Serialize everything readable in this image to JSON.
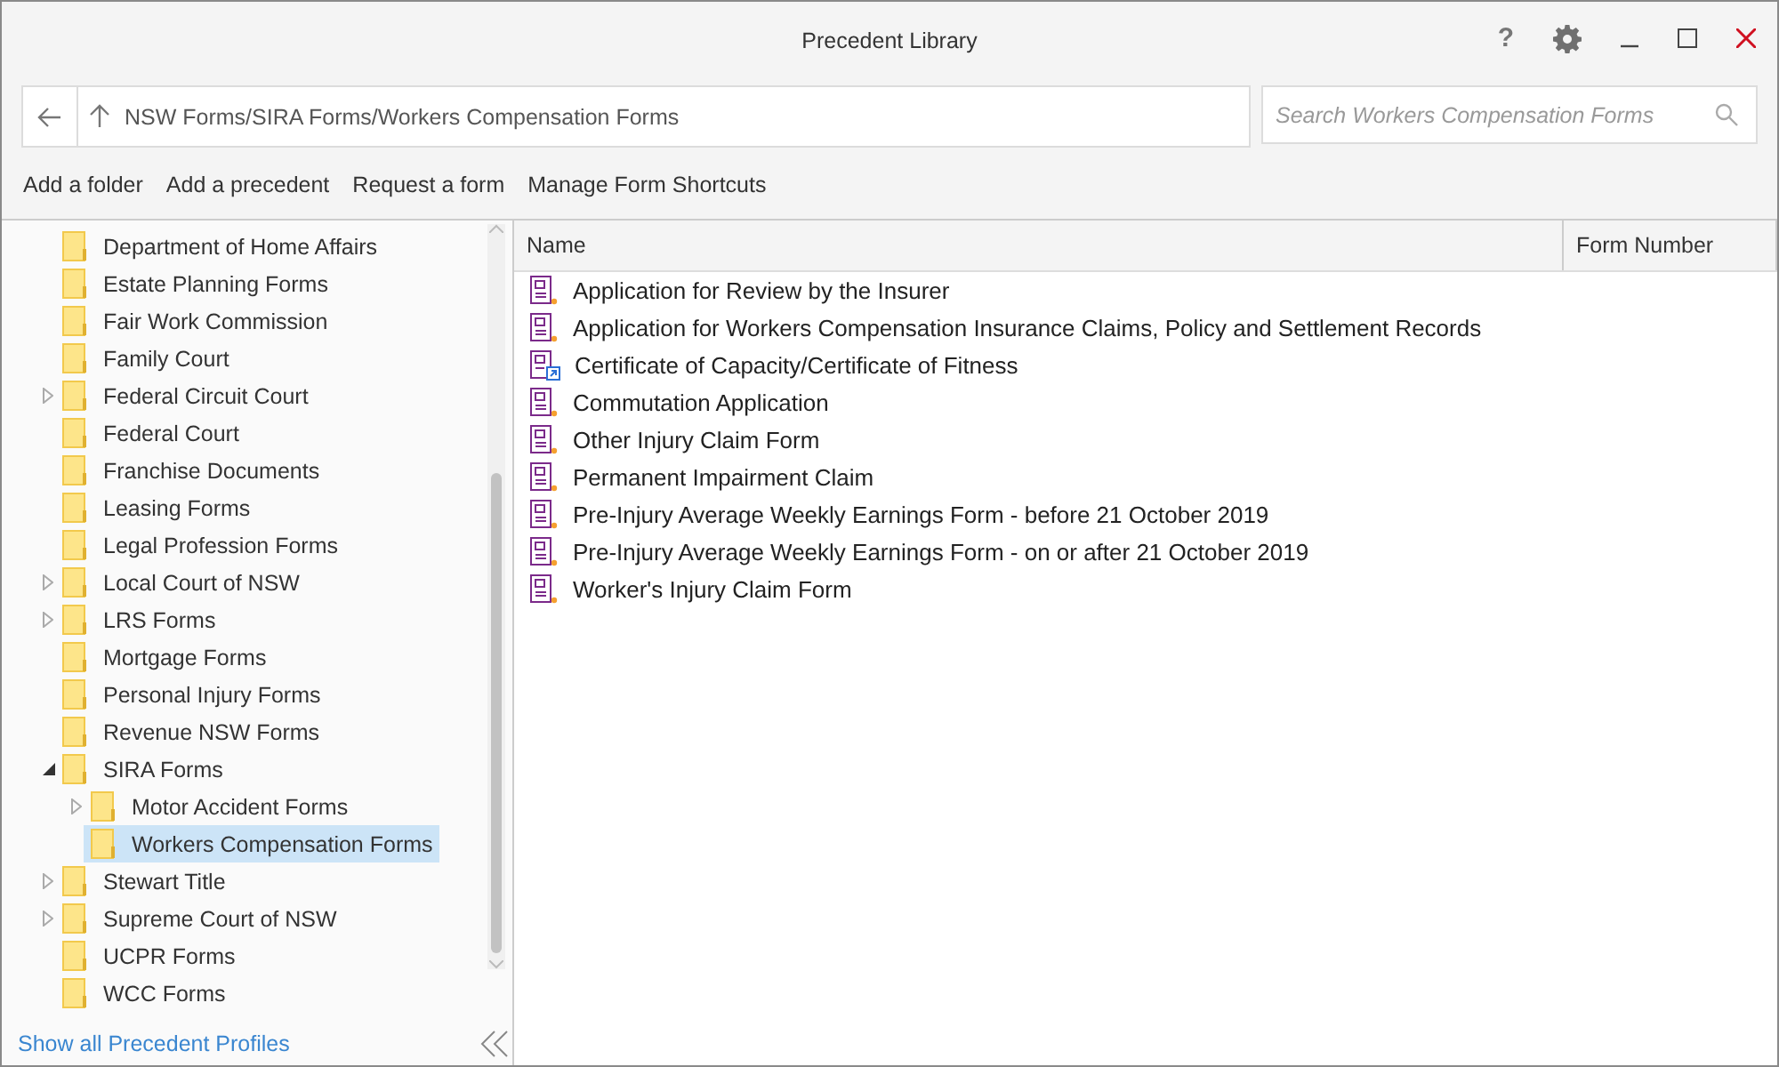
{
  "window": {
    "title": "Precedent Library"
  },
  "title_buttons": [
    "?"
  ],
  "address": {
    "path": "NSW Forms/SIRA Forms/Workers Compensation Forms"
  },
  "search": {
    "placeholder": "Search Workers Compensation Forms"
  },
  "toolbar": [
    "Add a folder",
    "Add a precedent",
    "Request a form",
    "Manage Form Shortcuts"
  ],
  "tree": [
    {
      "label": "Department of Home Affairs",
      "expandable": false,
      "selected": false
    },
    {
      "label": "Estate Planning Forms",
      "expandable": false,
      "selected": false
    },
    {
      "label": "Fair Work Commission",
      "expandable": false,
      "selected": false
    },
    {
      "label": "Family Court",
      "expandable": false,
      "selected": false
    },
    {
      "label": "Federal Circuit Court",
      "expandable": true,
      "expanded": false,
      "selected": false
    },
    {
      "label": "Federal Court",
      "expandable": false,
      "selected": false
    },
    {
      "label": "Franchise Documents",
      "expandable": false,
      "selected": false
    },
    {
      "label": "Leasing Forms",
      "expandable": false,
      "selected": false
    },
    {
      "label": "Legal Profession Forms",
      "expandable": false,
      "selected": false
    },
    {
      "label": "Local Court of NSW",
      "expandable": true,
      "expanded": false,
      "selected": false
    },
    {
      "label": "LRS Forms",
      "expandable": true,
      "expanded": false,
      "selected": false
    },
    {
      "label": "Mortgage Forms",
      "expandable": false,
      "selected": false
    },
    {
      "label": "Personal Injury Forms",
      "expandable": false,
      "selected": false
    },
    {
      "label": "Revenue NSW Forms",
      "expandable": false,
      "selected": false
    },
    {
      "label": "SIRA Forms",
      "expandable": true,
      "expanded": true,
      "selected": false,
      "children": [
        {
          "label": "Motor Accident Forms",
          "expandable": true,
          "expanded": false,
          "selected": false
        },
        {
          "label": "Workers Compensation Forms",
          "expandable": false,
          "selected": true
        }
      ]
    },
    {
      "label": "Stewart Title",
      "expandable": true,
      "expanded": false,
      "selected": false
    },
    {
      "label": "Supreme Court of NSW",
      "expandable": true,
      "expanded": false,
      "selected": false
    },
    {
      "label": "UCPR Forms",
      "expandable": false,
      "selected": false
    },
    {
      "label": "WCC Forms",
      "expandable": false,
      "selected": false
    }
  ],
  "footer_link": "Show all Precedent Profiles",
  "table": {
    "columns": [
      "Name",
      "Form Number"
    ],
    "rows": [
      {
        "name": "Application for Review by the Insurer",
        "kind": "pdf"
      },
      {
        "name": "Application for Workers Compensation Insurance Claims, Policy and Settlement Records",
        "kind": "pdf"
      },
      {
        "name": "Certificate of Capacity/Certificate of Fitness",
        "kind": "shortcut"
      },
      {
        "name": "Commutation Application",
        "kind": "pdf"
      },
      {
        "name": "Other Injury Claim Form",
        "kind": "pdf"
      },
      {
        "name": "Permanent Impairment Claim",
        "kind": "pdf"
      },
      {
        "name": "Pre-Injury Average Weekly Earnings Form - before 21 October 2019",
        "kind": "pdf"
      },
      {
        "name": "Pre-Injury Average Weekly Earnings Form - on or after 21 October 2019",
        "kind": "pdf"
      },
      {
        "name": "Worker's Injury Claim Form",
        "kind": "pdf"
      }
    ]
  }
}
